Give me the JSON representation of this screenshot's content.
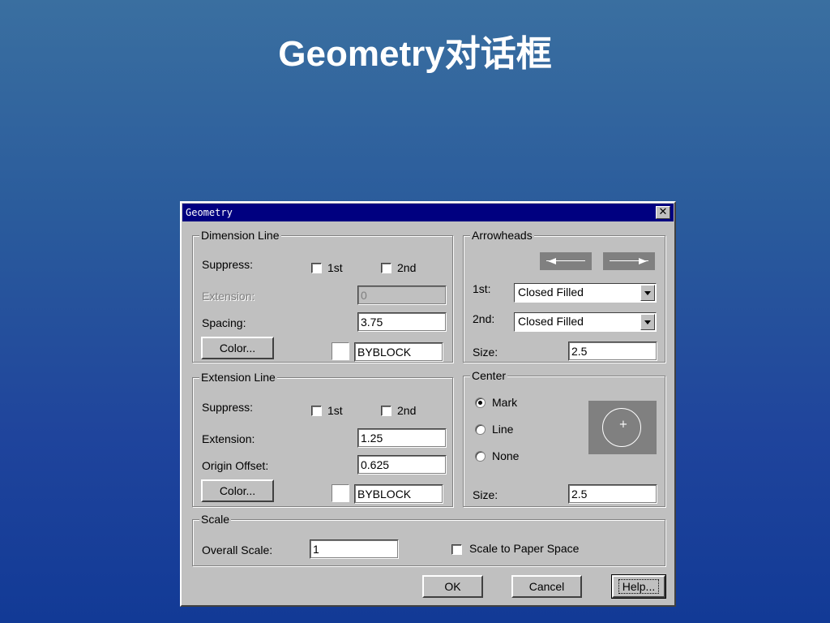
{
  "slide": {
    "title": "Geometry对话框"
  },
  "dialog": {
    "title": "Geometry",
    "close_glyph": "✕",
    "dimension_line": {
      "group_label": "Dimension Line",
      "suppress_label": "Suppress:",
      "first_label": "1st",
      "second_label": "2nd",
      "first_checked": false,
      "second_checked": false,
      "extension_label": "Extension:",
      "extension_value": "0",
      "spacing_label": "Spacing:",
      "spacing_value": "3.75",
      "color_button": "Color...",
      "color_value": "BYBLOCK"
    },
    "arrowheads": {
      "group_label": "Arrowheads",
      "first_label": "1st:",
      "first_value": "Closed Filled",
      "second_label": "2nd:",
      "second_value": "Closed Filled",
      "size_label": "Size:",
      "size_value": "2.5"
    },
    "extension_line": {
      "group_label": "Extension Line",
      "suppress_label": "Suppress:",
      "first_label": "1st",
      "second_label": "2nd",
      "first_checked": false,
      "second_checked": false,
      "extension_label": "Extension:",
      "extension_value": "1.25",
      "origin_offset_label": "Origin Offset:",
      "origin_offset_value": "0.625",
      "color_button": "Color...",
      "color_value": "BYBLOCK"
    },
    "center": {
      "group_label": "Center",
      "options": [
        {
          "label": "Mark",
          "selected": true
        },
        {
          "label": "Line",
          "selected": false
        },
        {
          "label": "None",
          "selected": false
        }
      ],
      "preview_glyph": "+",
      "size_label": "Size:",
      "size_value": "2.5"
    },
    "scale": {
      "group_label": "Scale",
      "overall_label": "Overall Scale:",
      "overall_value": "1",
      "paper_space_label": "Scale to Paper Space",
      "paper_space_checked": false
    },
    "buttons": {
      "ok": "OK",
      "cancel": "Cancel",
      "help": "Help..."
    },
    "colors": {
      "titlebar": "#000080",
      "face": "#c0c0c0",
      "preview": "#808080"
    }
  }
}
